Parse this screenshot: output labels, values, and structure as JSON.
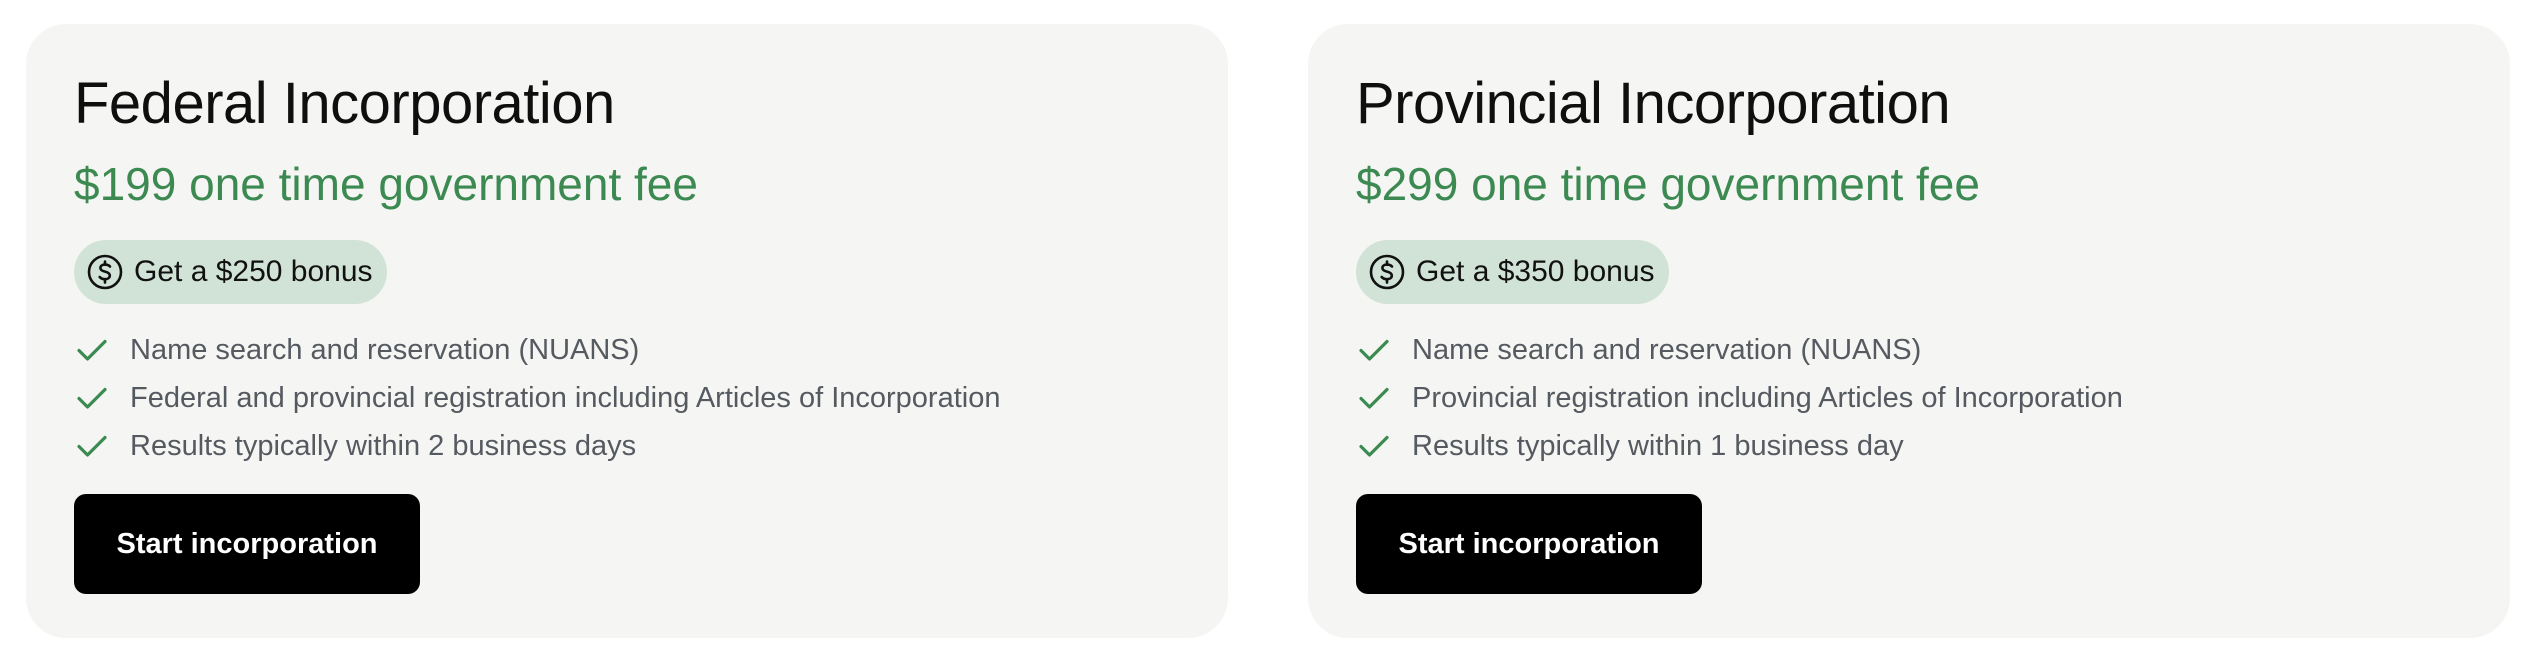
{
  "cards": [
    {
      "title": "Federal Incorporation",
      "fee": "$199 one time government fee",
      "bonus": {
        "icon": "dollar-coin-icon",
        "label": "Get a $250 bonus"
      },
      "features": [
        "Name search and reservation (NUANS)",
        "Federal and provincial registration including Articles of Incorporation",
        "Results typically within 2 business days"
      ],
      "cta_label": "Start incorporation"
    },
    {
      "title": "Provincial Incorporation",
      "fee": "$299 one time government fee",
      "bonus": {
        "icon": "dollar-coin-icon",
        "label": "Get a $350 bonus"
      },
      "features": [
        "Name search and reservation (NUANS)",
        "Provincial registration including Articles of Incorporation",
        "Results typically within 1 business day"
      ],
      "cta_label": "Start incorporation"
    }
  ],
  "colors": {
    "card_bg": "#f5f5f3",
    "accent_green": "#3c8a52",
    "bonus_bg": "#d1e3d6",
    "button_bg": "#000000",
    "button_text": "#ffffff"
  },
  "icons": {
    "check": "check-icon",
    "bonus": "dollar-coin-icon"
  }
}
